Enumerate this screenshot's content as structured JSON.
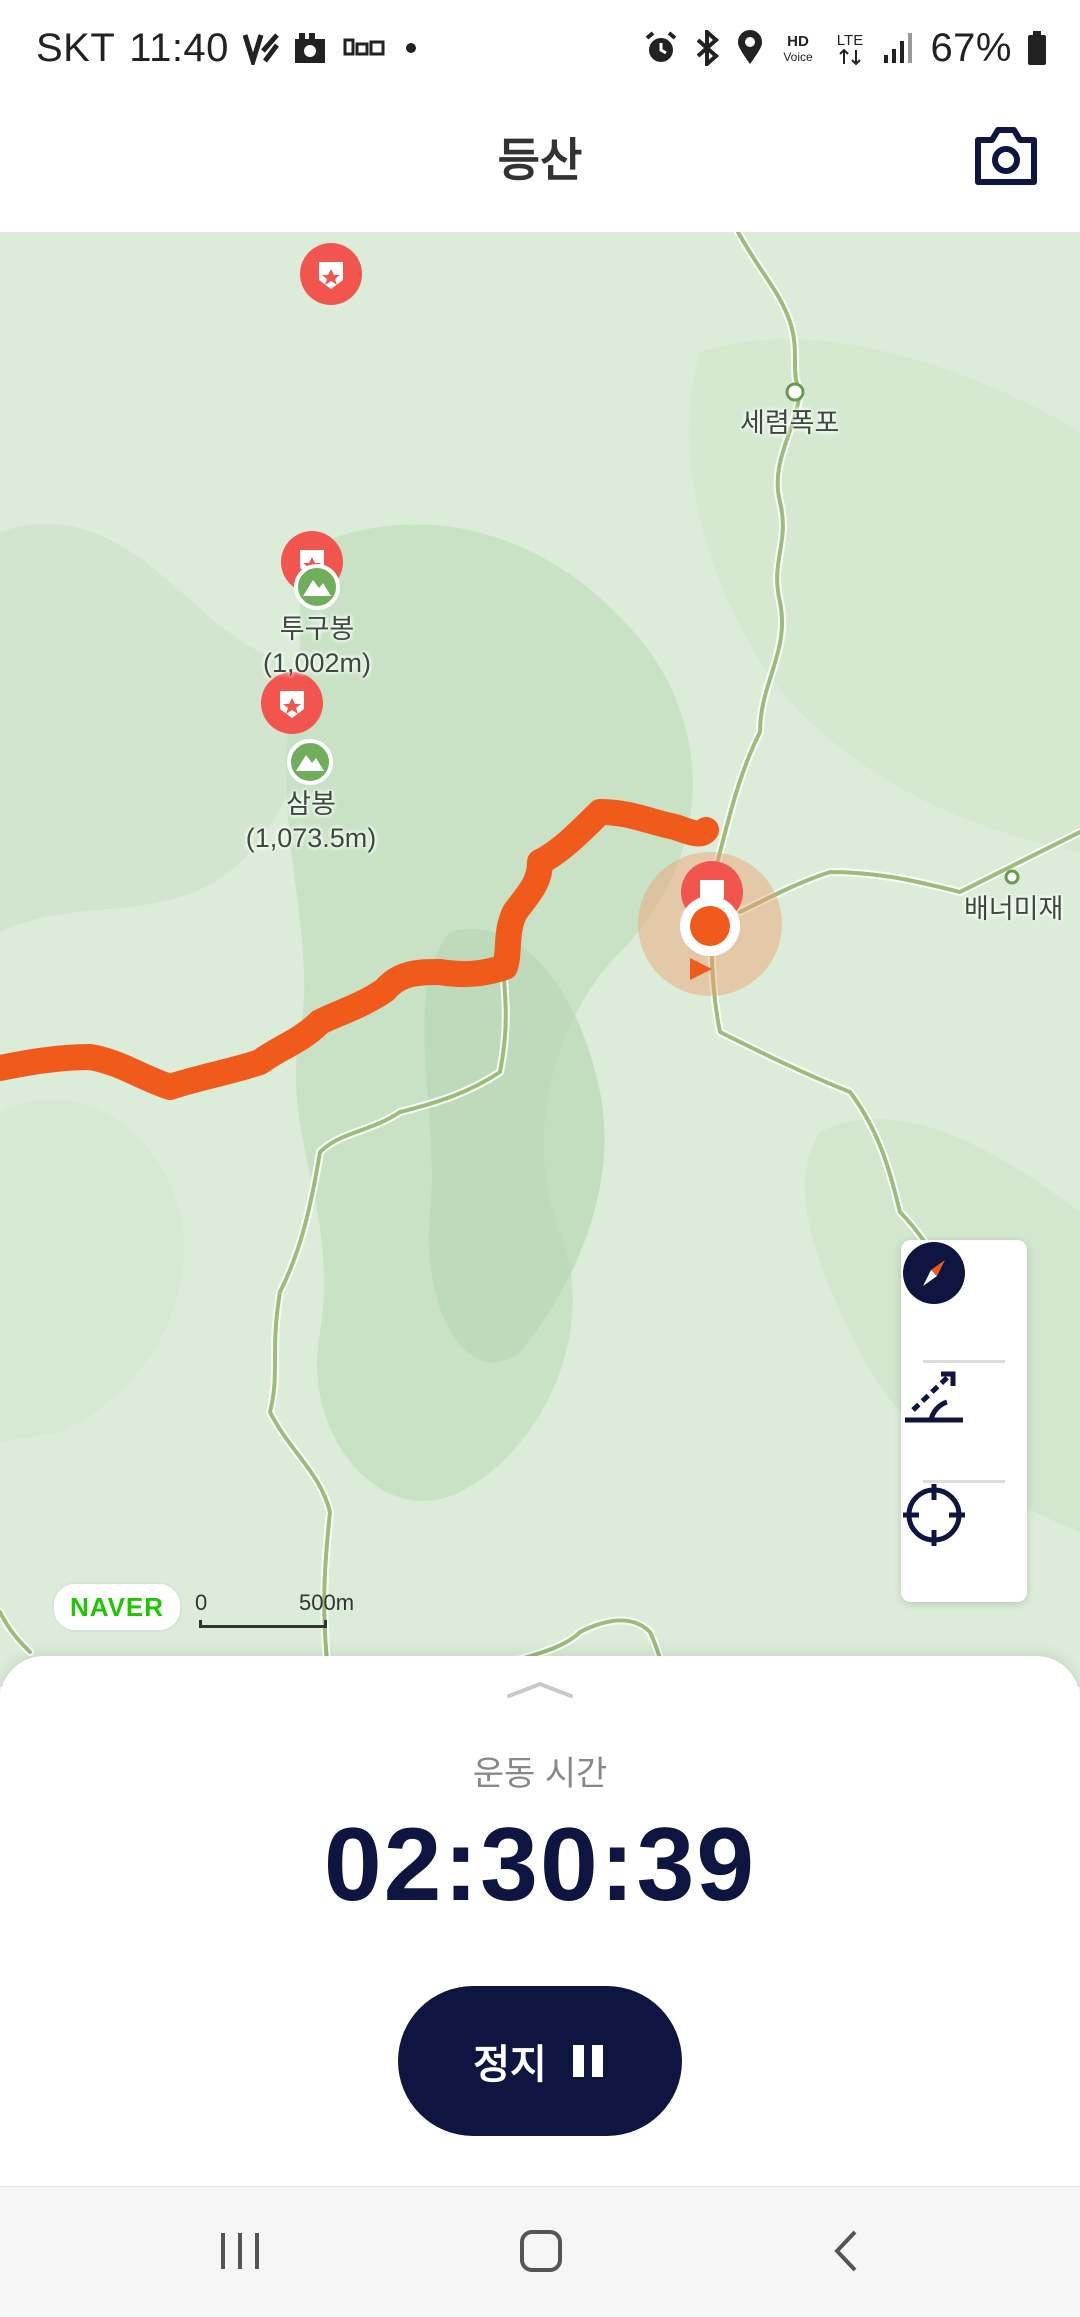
{
  "status_bar": {
    "carrier": "SKT",
    "time": "11:40",
    "battery": "67%",
    "icons_left": [
      "signal-alert-icon",
      "photo-icon",
      "dmb-icon",
      "dot-icon"
    ],
    "icons_right": [
      "alarm-icon",
      "bluetooth-icon",
      "location-icon",
      "hd-voice-icon",
      "lte-icon",
      "signal-icon",
      "battery-icon"
    ],
    "hd_voice": "HD Voice",
    "network": "LTE"
  },
  "header": {
    "title": "등산",
    "camera_icon": "camera-icon"
  },
  "map": {
    "labels": {
      "waterfall": "세렴폭포",
      "peak1_name": "투구봉",
      "peak1_height": "(1,002m)",
      "peak2_name": "삼봉",
      "peak2_height": "(1,073.5m)",
      "pass": "배너미재"
    },
    "provider": "NAVER",
    "scale_start": "0",
    "scale_end": "500m",
    "colors": {
      "route": "#f05a1a",
      "background": "#dbecd8",
      "trail": "#9cbd7a",
      "marker": "#f2554e"
    }
  },
  "map_controls": {
    "compass": "compass-icon",
    "slope": "slope-icon",
    "locate": "crosshair-icon"
  },
  "exercise": {
    "label": "운동 시간",
    "time": "02:30:39",
    "stop_label": "정지"
  },
  "nav_bar": {
    "recent": "recent-apps-icon",
    "home": "home-icon",
    "back": "back-icon"
  }
}
